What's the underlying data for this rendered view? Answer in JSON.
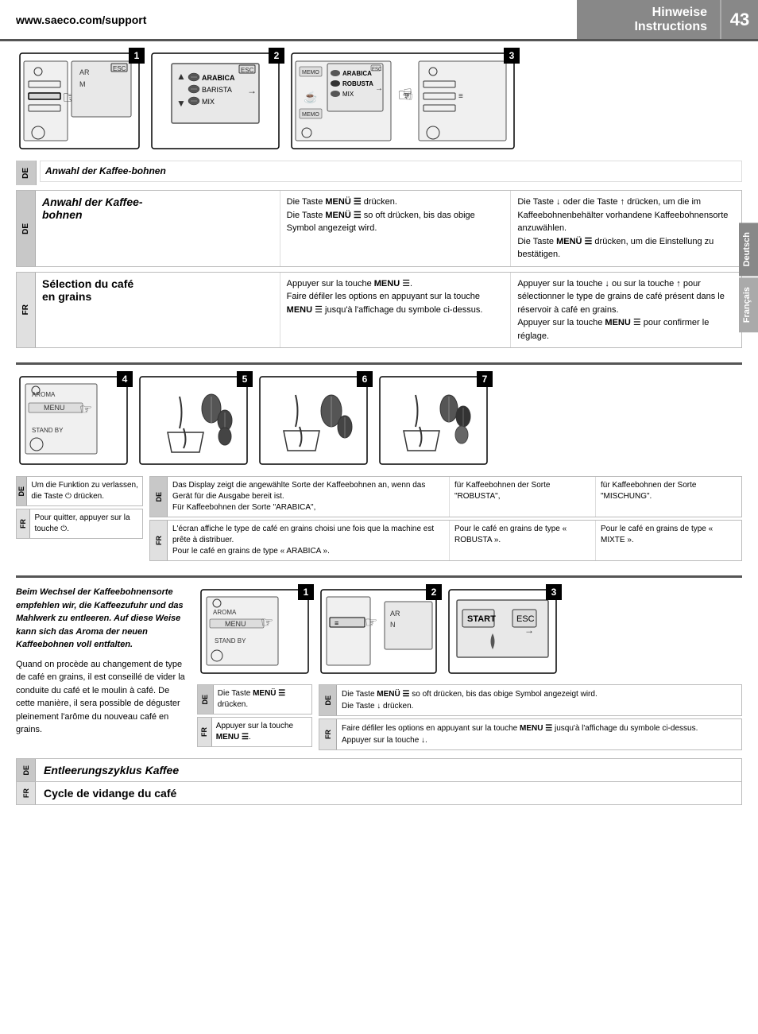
{
  "header": {
    "url": "www.saeco.com/support",
    "title_line1": "Hinweise",
    "title_line2": "Instructions",
    "page_number": "43"
  },
  "section1": {
    "title_de": "Anwahl der Kaffee-bohnen",
    "title_fr": "Sélection du café en grains",
    "de_col1": "Die Taste MENÜ drücken.\nDie Taste MENÜ so oft drücken, bis das obige Symbol angezeigt wird.",
    "de_col2": "Die Taste oder die Taste drücken, um die im Kaffeebohnenbehälter vorhandene Kaffeebohnensorte anzuwählen.\nDie Taste MENÜ drücken, um die Einstellung zu bestätigen.",
    "fr_col1": "Appuyer sur la touche MENU.\nFaire défiler les options en appuyant sur la touche MENU jusqu'à l'affichage du symbole ci-dessus.",
    "fr_col2": "Appuyer sur la touche ou sur la touche pour sélectionner le type de grains de café présent dans le réservoir à café en grains.\nAppuyer sur la touche MENU pour confirmer le réglage."
  },
  "section2": {
    "de_step4": "Um die Funktion zu verlassen, die Taste drücken.",
    "fr_step4": "Pour quitter, appuyer sur la touche.",
    "de_steps567": "Das Display zeigt die angewählte Sorte der Kaffeebohnen an, wenn das Gerät für die Ausgabe bereit ist.\nFür Kaffeebohnen der Sorte \"ARABICA\",\nL'écran affiche le type de café en grains choisi une fois que la machine est prête à distribuer.\nPour le café en grains de type « ARABICA ».",
    "de_step6": "für Kaffeebohnen der Sorte \"ROBUSTA\",",
    "fr_step6": "Pour le café en grains de type « ROBUSTA ».",
    "de_step7": "für Kaffeebohnen der Sorte \"MISCHUNG\".",
    "fr_step7": "Pour le café en grains de type « MIXTE »."
  },
  "section3": {
    "title_de": "Entleerungszyklus Kaffee",
    "title_fr": "Cycle de vidange du café",
    "intro_de": "Beim Wechsel der Kaffeebohnensorte empfehlen wir, die Kaffeezufuhr und das Mahlwerk zu entleeren. Auf diese Weise kann sich das Aroma der neuen Kaffeebohnen voll entfalten.",
    "intro_fr": "Quand on procède au changement de type de café en grains, il est conseillé de vider la conduite du café et le moulin à café. De cette manière, il sera possible de déguster pleinement l'arôme du nouveau café en grains.",
    "de_step1_caption": "Die Taste MENÜ drücken.",
    "fr_step1_caption": "Appuyer sur la touche MENU.",
    "de_step2": "Die Taste MENÜ so oft drücken, bis das obige Symbol angezeigt wird.\nDie Taste drücken.",
    "fr_step2": "Faire défiler les options en appuyant sur la touche MENU jusqu'à l'affichage du symbole ci-dessus.\nAppuyer sur la touche."
  },
  "steps_row1": [
    "1",
    "2",
    "3"
  ],
  "steps_row2": [
    "4",
    "5",
    "6",
    "7"
  ],
  "steps_row3": [
    "1",
    "2",
    "3"
  ],
  "sidebar": {
    "deutsch": "Deutsch",
    "francais": "Français"
  }
}
